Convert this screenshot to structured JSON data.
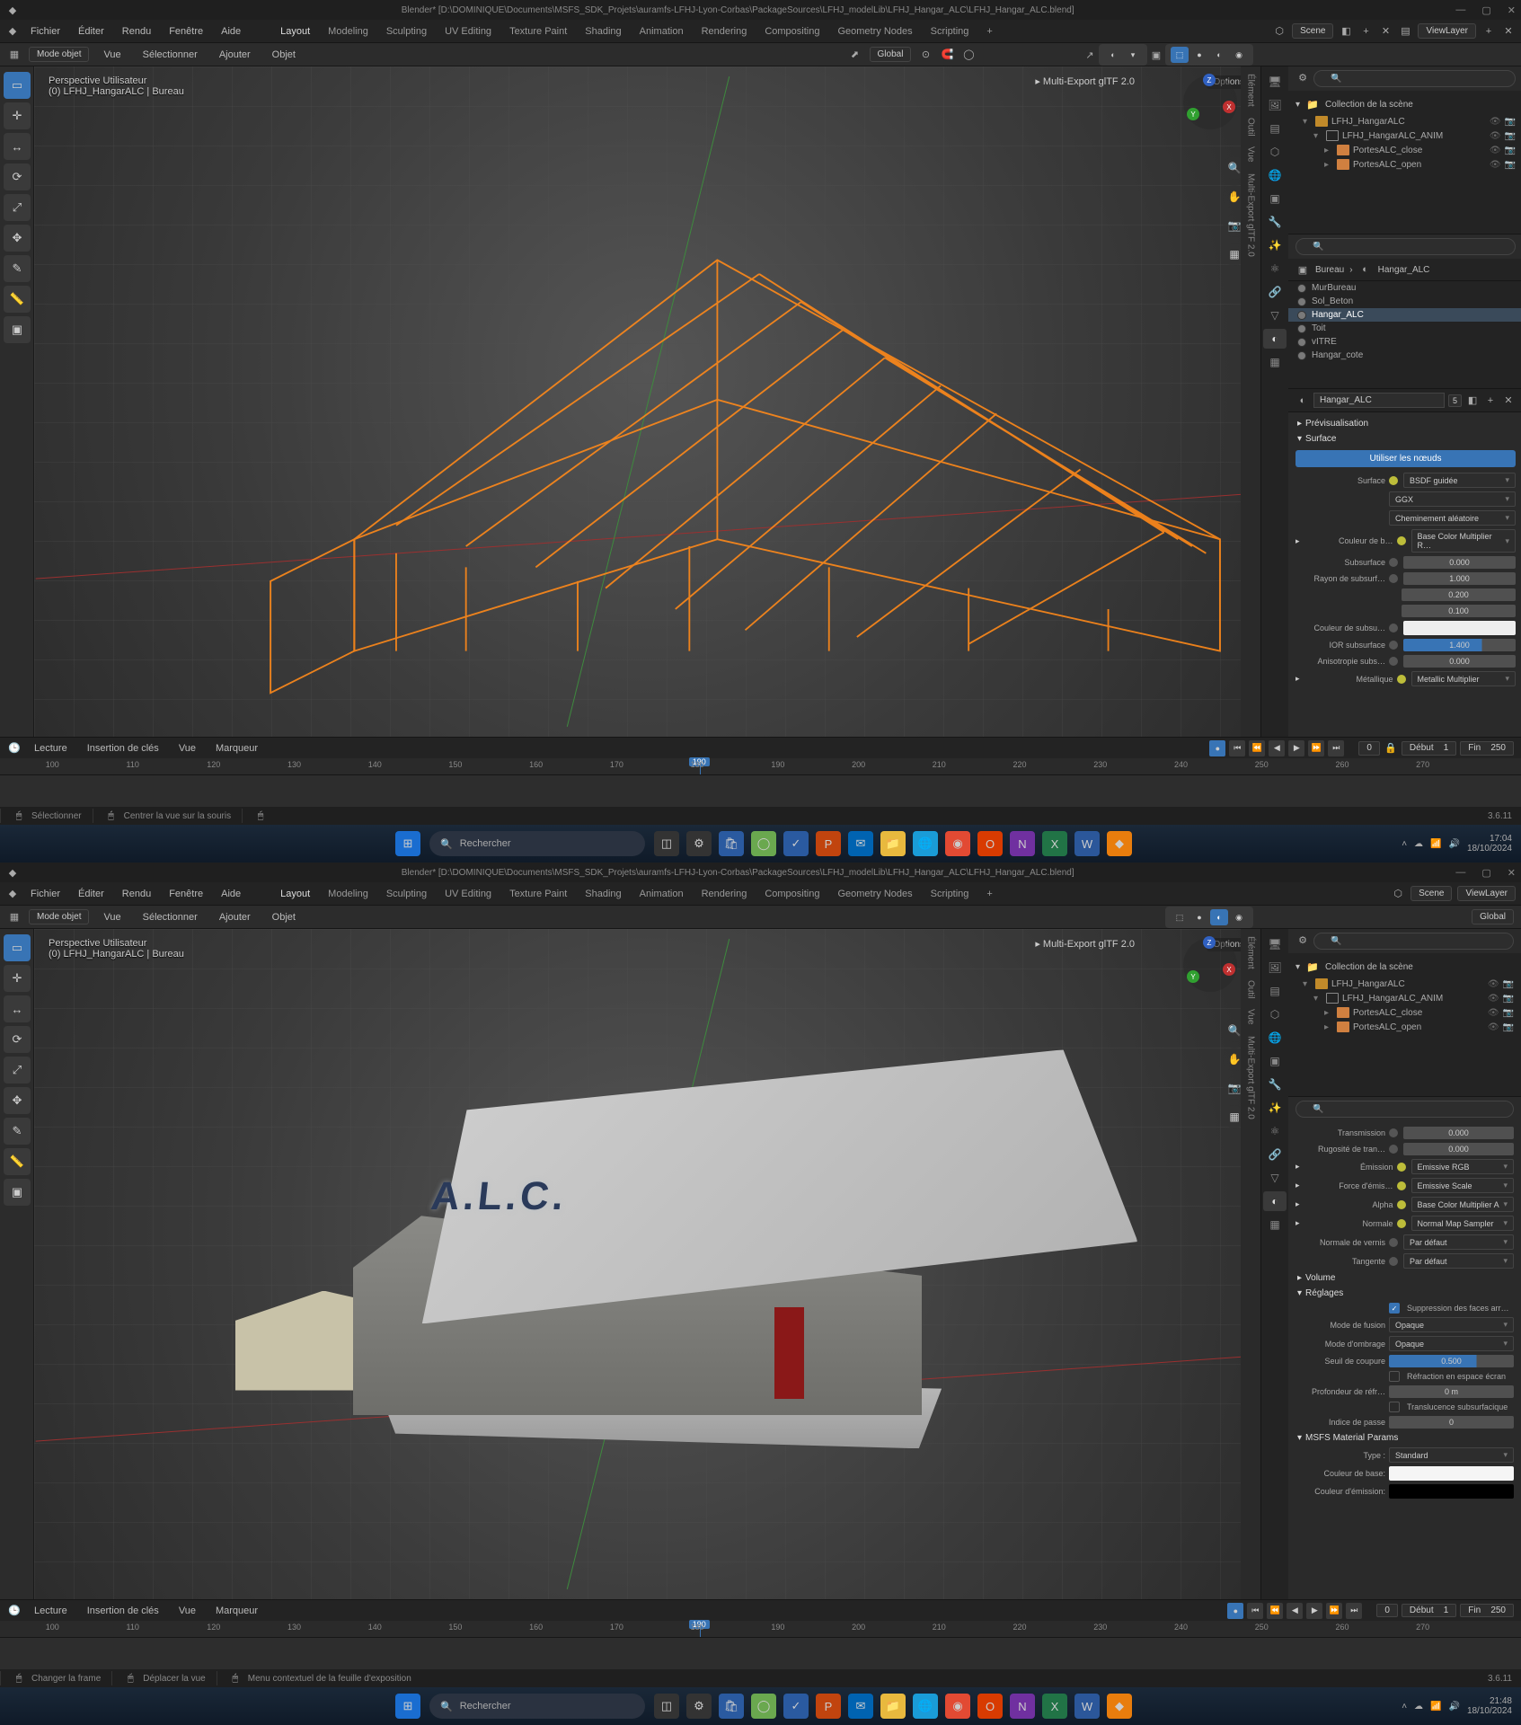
{
  "title_path": "Blender* [D:\\DOMINIQUE\\Documents\\MSFS_SDK_Projets\\auramfs-LFHJ-Lyon-Corbas\\PackageSources\\LFHJ_modelLib\\LFHJ_Hangar_ALC\\LFHJ_Hangar_ALC.blend]",
  "menu": [
    "Fichier",
    "Éditer",
    "Rendu",
    "Fenêtre",
    "Aide"
  ],
  "workspaces": [
    "Layout",
    "Modeling",
    "Sculpting",
    "UV Editing",
    "Texture Paint",
    "Shading",
    "Animation",
    "Rendering",
    "Compositing",
    "Geometry Nodes",
    "Scripting",
    "+"
  ],
  "scene_label": "Scene",
  "viewlayer_label": "ViewLayer",
  "header3d": {
    "mode": "Mode objet",
    "view": "Vue",
    "select": "Sélectionner",
    "add": "Ajouter",
    "object": "Objet",
    "orient": "Global"
  },
  "viewport_info": {
    "line1": "Perspective Utilisateur",
    "line2": "(0) LFHJ_HangarALC | Bureau"
  },
  "multi_export": "Multi-Export glTF 2.0",
  "options_label": "Options",
  "vertical_tabs": [
    "Élément",
    "Outil",
    "Vue",
    "Multi-Export glTF 2.0"
  ],
  "outliner_head": "Collection de la scène",
  "outliner": [
    {
      "name": "LFHJ_HangarALC",
      "depth": 1,
      "type": "cam"
    },
    {
      "name": "LFHJ_HangarALC_ANIM",
      "depth": 2,
      "type": "empty"
    },
    {
      "name": "PortesALC_close",
      "depth": 3,
      "type": "mesh"
    },
    {
      "name": "PortesALC_open",
      "depth": 3,
      "type": "mesh"
    }
  ],
  "breadcrumb": [
    "Bureau",
    "Hangar_ALC"
  ],
  "materials": [
    "MurBureau",
    "Sol_Beton",
    "Hangar_ALC",
    "Toit",
    "vITRE",
    "Hangar_cote"
  ],
  "mat_active": "Hangar_ALC",
  "mat_users": "5",
  "panels_top": {
    "preview": "Prévisualisation",
    "surface_head": "Surface",
    "use_nodes": "Utiliser les nœuds",
    "surface_label": "Surface",
    "surface_val": "BSDF guidée",
    "dist": "GGX",
    "subsurf_method": "Cheminement aléatoire",
    "base_color_label": "Couleur de b…",
    "base_color_val": "Base Color Multiplier R…",
    "subsurface_label": "Subsurface",
    "subsurface_val": "0.000",
    "subsurf_radius_label": "Rayon de subsurf…",
    "r1": "1.000",
    "r2": "0.200",
    "r3": "0.100",
    "subsurf_color_label": "Couleur de subsu…",
    "ior_label": "IOR subsurface",
    "ior_val": "1.400",
    "aniso_label": "Anisotropie subs…",
    "aniso_val": "0.000",
    "metallic_label": "Métallique",
    "metallic_val": "Metallic Multiplier"
  },
  "panels_bottom": {
    "transmission_label": "Transmission",
    "transmission_val": "0.000",
    "rough_trans_label": "Rugosité de tran…",
    "rough_trans_val": "0.000",
    "emission_label": "Émission",
    "emission_val": "Emissive RGB",
    "emiss_strength_label": "Force d'émis…",
    "emiss_strength_val": "Emissive Scale",
    "alpha_label": "Alpha",
    "alpha_val": "Base Color Multiplier A",
    "normal_label": "Normale",
    "normal_val": "Normal Map Sampler",
    "clearcoat_n_label": "Normale de vernis",
    "clearcoat_n_val": "Par défaut",
    "tangent_label": "Tangente",
    "tangent_val": "Par défaut",
    "volume_head": "Volume",
    "settings_head": "Réglages",
    "backface_label": "Suppression des faces arr…",
    "blend_label": "Mode de fusion",
    "blend_val": "Opaque",
    "shadow_label": "Mode d'ombrage",
    "shadow_val": "Opaque",
    "clip_label": "Seuil de coupure",
    "clip_val": "0.500",
    "ssr_label": "Réfraction en espace écran",
    "refr_depth_label": "Profondeur de réfr…",
    "refr_depth_val": "0 m",
    "sss_label": "Translucence subsurfacique",
    "pass_label": "Indice de passe",
    "pass_val": "0",
    "msfs_head": "MSFS Material Params",
    "type_label": "Type :",
    "type_val": "Standard",
    "basecol_label": "Couleur de base:",
    "emisscol_label": "Couleur d'émission:"
  },
  "timeline": {
    "menu": [
      "Lecture",
      "Insertion de clés",
      "Vue",
      "Marqueur"
    ],
    "current": "0",
    "start_lbl": "Début",
    "start": "1",
    "end_lbl": "Fin",
    "end_top": "250",
    "end_bot": "250"
  },
  "ruler": [
    "100",
    "110",
    "120",
    "130",
    "140",
    "150",
    "160",
    "170",
    "180",
    "190",
    "200",
    "210",
    "220",
    "230",
    "240",
    "250",
    "260",
    "270"
  ],
  "status_top": {
    "a": "Sélectionner",
    "b": "Centrer la vue sur la souris"
  },
  "status_bottom": {
    "a": "Changer la frame",
    "b": "Déplacer la vue",
    "c": "Menu contextuel de la feuille d'exposition"
  },
  "version": "3.6.11",
  "taskbar": {
    "search": "Rechercher"
  },
  "clock_top": {
    "time": "17:04",
    "date": "18/10/2024"
  },
  "clock_bot": {
    "time": "21:48",
    "date": "18/10/2024"
  },
  "alc_text": "A.L.C."
}
